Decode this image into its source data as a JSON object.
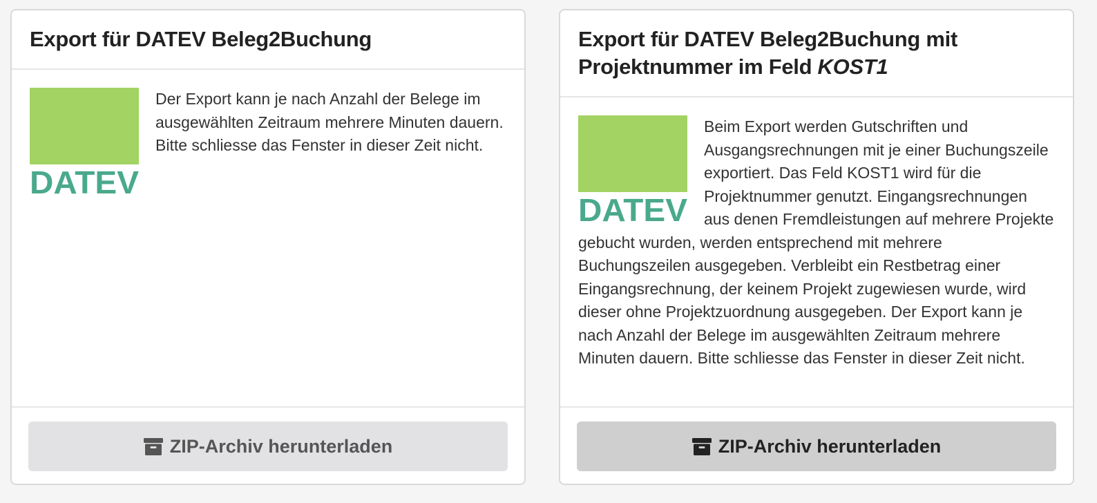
{
  "cards": [
    {
      "title": "Export für DATEV Beleg2Buchung",
      "logo_text": "DATEV",
      "logo_icon": "datev-logo",
      "description": "Der Export kann je nach Anzahl der Belege im ausgewählten Zeitraum mehrere Minuten dauern. Bitte schliesse das Fenster in dieser Zeit nicht.",
      "button_label": "ZIP-Archiv herunterladen",
      "button_icon": "archive-icon",
      "button_state": "disabled"
    },
    {
      "title_main": "Export für DATEV Beleg2Buchung mit Projektnummer im Feld ",
      "title_emphasis": "KOST1",
      "logo_text": "DATEV",
      "logo_icon": "datev-logo",
      "description": "Beim Export werden Gutschriften und Ausgangsrechnungen mit je einer Buchungszeile exportiert. Das Feld KOST1 wird für die Projektnummer genutzt. Eingangsrechnungen aus denen Fremdleistungen auf mehrere Projekte gebucht wurden, werden entsprechend mit mehrere Buchungszeilen ausgegeben. Verbleibt ein Restbetrag einer Eingangsrechnung, der keinem Projekt zugewiesen wurde, wird dieser ohne Projektzuordnung ausgegeben. Der Export kann je nach Anzahl der Belege im ausgewählten Zeitraum mehrere Minuten dauern. Bitte schliesse das Fenster in dieser Zeit nicht.",
      "button_label": "ZIP-Archiv herunterladen",
      "button_icon": "archive-icon",
      "button_state": "active"
    }
  ],
  "colors": {
    "logo_green": "#a3d363",
    "logo_teal": "#4aa98c"
  }
}
